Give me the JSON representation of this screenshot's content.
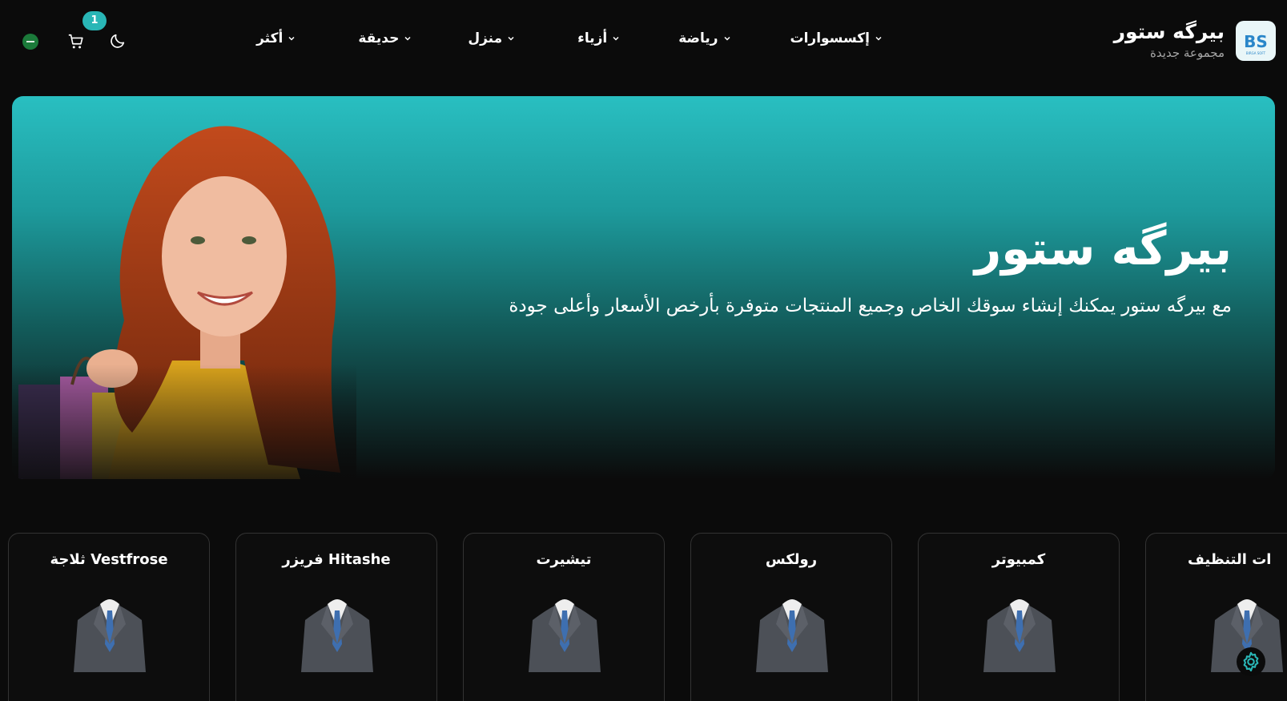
{
  "header": {
    "brand_name": "بيرگه ستور",
    "brand_sub": "مجموعة جديدة",
    "cart_count": "1",
    "nav": [
      {
        "label": "إكسسوارات"
      },
      {
        "label": "رياضة"
      },
      {
        "label": "أزياء"
      },
      {
        "label": "منزل"
      },
      {
        "label": "حديقة"
      },
      {
        "label": "أكثر"
      }
    ]
  },
  "hero": {
    "title": "بيرگه ستور",
    "description": "مع بيرگه ستور يمكنك إنشاء سوقك الخاص وجميع المنتجات متوفرة بأرخص الأسعار وأعلى جودة"
  },
  "categories": [
    {
      "title": "Vestfrose ثلاجة"
    },
    {
      "title": "Hitashe فريزر"
    },
    {
      "title": "تيشيرت"
    },
    {
      "title": "رولكس"
    },
    {
      "title": "كمبيوتر"
    },
    {
      "title": "ات التنظيف"
    }
  ],
  "colors": {
    "accent": "#29b6b6",
    "background": "#0b0b0b"
  }
}
